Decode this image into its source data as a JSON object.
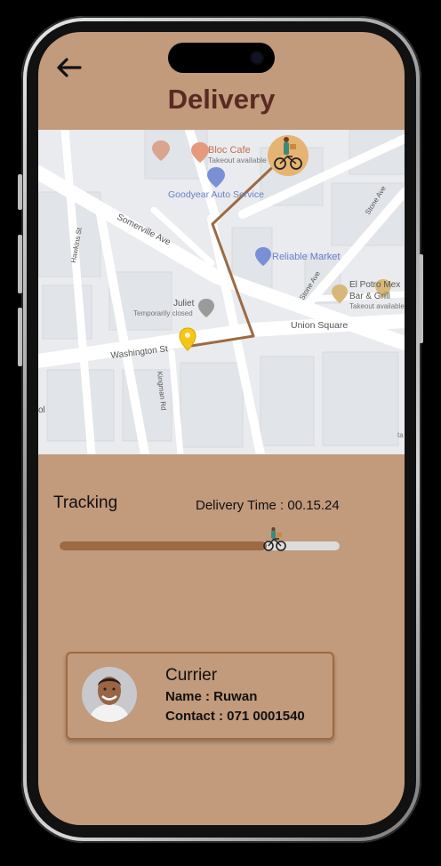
{
  "app": {
    "title": "Delivery"
  },
  "navigation": {
    "back_icon": "arrow-left-icon"
  },
  "map": {
    "places": {
      "bloc_cafe": "Bloc Cafe",
      "bloc_cafe_sub": "Takeout available",
      "goodyear": "Goodyear Auto Service",
      "somerville": "Somerville Ave",
      "hawkins": "Hawkins St",
      "reliable": "Reliable Market",
      "el_potro": "El Potro Mex",
      "el_potro_2": "Bar & Grill",
      "el_potro_sub": "Takeout available",
      "stone_ave": "Stone Ave",
      "stone_ave_2": "Stone Ave",
      "juliet": "Juliet",
      "juliet_sub": "Temporarily closed",
      "union_square": "Union Square",
      "washington": "Washington St",
      "kingman": "Kingman Rd",
      "edge_left": "ol",
      "edge_right": "ta"
    },
    "route_color": "#9c6a43",
    "pin_color": "#f5c518"
  },
  "tracking": {
    "label": "Tracking",
    "delivery_time": "Delivery Time : 00.15.24",
    "progress": 0.74,
    "fill_color": "#9c6a43",
    "track_color": "#dcdcdc"
  },
  "courier": {
    "title": "Currier",
    "name": "Name : Ruwan",
    "contact": "Contact :  071 0001540"
  },
  "colors": {
    "background": "#c29a7c",
    "title": "#5a2a22"
  }
}
